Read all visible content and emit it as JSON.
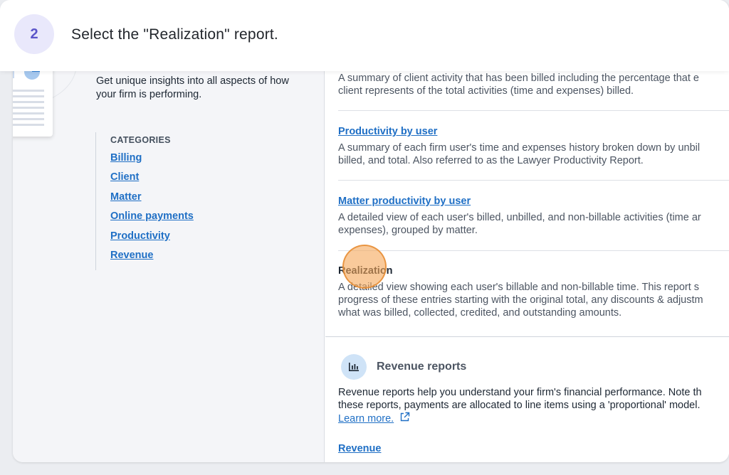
{
  "banner": {
    "step_number": "2",
    "instruction": "Select the \"Realization\" report."
  },
  "sidebar": {
    "intro": "Get unique insights into all aspects of how your firm is performing.",
    "categories_title": "CATEGORIES",
    "categories": [
      "Billing",
      "Client",
      "Matter",
      "Online payments",
      "Productivity",
      "Revenue"
    ]
  },
  "reports": {
    "client_summary_desc_1": "A summary of client activity that has been billed including the percentage that e",
    "client_summary_desc_2": "client represents of the total activities (time and expenses) billed.",
    "productivity_by_user": {
      "title": "Productivity by user",
      "desc_1": "A summary of each firm user's time and expenses history broken down by unbil",
      "desc_2": "billed, and total. Also referred to as the Lawyer Productivity Report."
    },
    "matter_productivity": {
      "title": "Matter productivity by user",
      "desc_1": "A detailed view of each user's billed, unbilled, and non-billable activities (time ar",
      "desc_2": "expenses), grouped by matter."
    },
    "realization": {
      "title": "Realization",
      "desc_1": "A detailed view showing each user's billable and non-billable time. This report s",
      "desc_2": "progress of these entries starting with the original total, any discounts & adjustm",
      "desc_3": "what was billed, collected, credited, and outstanding amounts."
    }
  },
  "revenue_section": {
    "icon": "bar-chart-icon",
    "title": "Revenue reports",
    "desc_1": "Revenue reports help you understand your firm's financial performance. Note th",
    "desc_2": "these reports, payments are allocated to line items using a 'proportional' model.",
    "learn_more": "Learn more.",
    "first_report": "Revenue"
  },
  "colors": {
    "link": "#1f6fc5",
    "step_bg": "#e9e8fb",
    "step_text": "#5b55c9",
    "highlight": "#f5a659"
  }
}
